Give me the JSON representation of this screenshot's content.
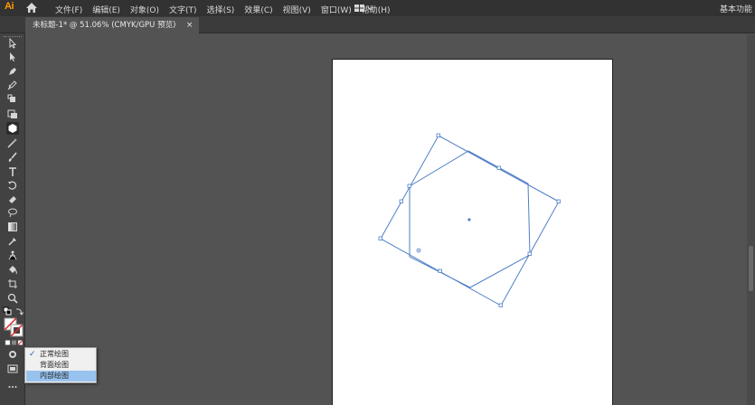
{
  "app": {
    "logo": "Ai",
    "menus": [
      "文件(F)",
      "编辑(E)",
      "对象(O)",
      "文字(T)",
      "选择(S)",
      "效果(C)",
      "视图(V)",
      "窗口(W)",
      "帮助(H)"
    ],
    "workspace_label": "基本功能"
  },
  "document": {
    "tab_title": "未标题-1* @ 51.06% (CMYK/GPU 预览)",
    "close_glyph": "×"
  },
  "toolbar": {
    "tools": [
      "selection-tool",
      "direct-selection-tool",
      "pen-tool",
      "curvature-tool",
      "blob-brush-tool",
      "shape-builder-tool",
      "polygon-tool",
      "magic-wand-tool",
      "paintbrush-tool",
      "type-tool",
      "rotate-tool",
      "eraser-tool",
      "lasso-tool",
      "gradient-tool",
      "eyedropper-tool",
      "puppet-warp-tool",
      "live-paint-tool",
      "artboard-tool",
      "zoom-tool"
    ],
    "active_tool": "polygon-tool"
  },
  "draw_mode_menu": {
    "items": [
      {
        "label": "正常绘图",
        "checked": true,
        "selected": false
      },
      {
        "label": "背面绘图",
        "checked": false,
        "selected": false
      },
      {
        "label": "内部绘图",
        "checked": false,
        "selected": true
      }
    ]
  },
  "colors": {
    "accent": "#ff9a00",
    "selection": "#4f7fc7",
    "menu_highlight": "#98c3ee"
  }
}
